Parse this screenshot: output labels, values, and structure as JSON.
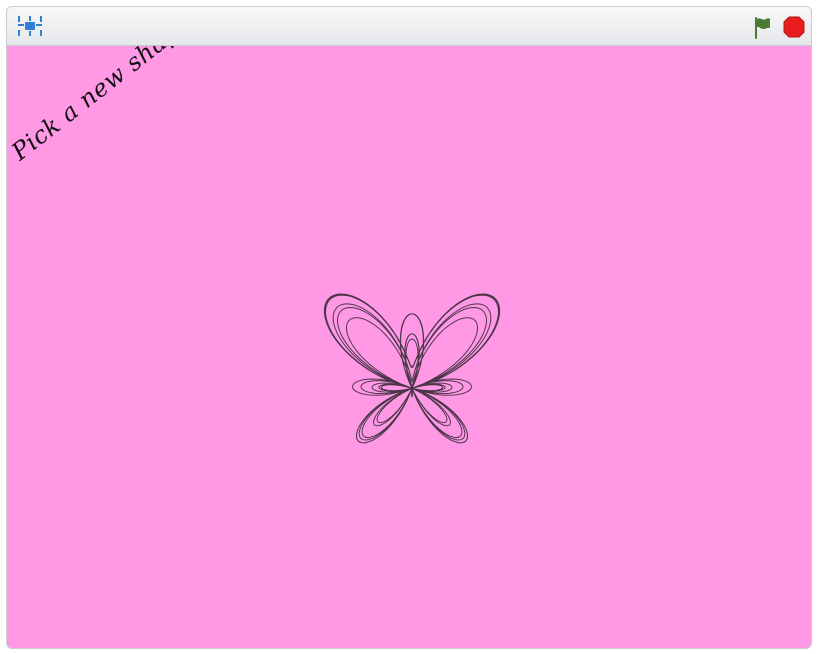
{
  "stage": {
    "background_color": "#ff99e6",
    "message": "Pick a new shape!",
    "shape_stroke_color": "#4a3548",
    "shape_name": "butterfly-curve"
  },
  "toolbar": {
    "fullscreen_icon": "fullscreen-icon",
    "flag_icon": "green-flag-icon",
    "stop_icon": "stop-sign-icon",
    "flag_color": "#4d7a33",
    "stop_color": "#e81e1e"
  }
}
